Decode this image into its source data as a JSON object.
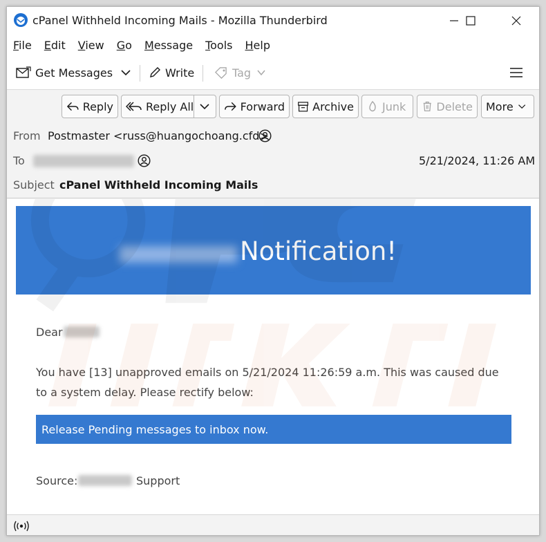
{
  "window": {
    "title": "cPanel Withheld Incoming Mails - Mozilla Thunderbird"
  },
  "menubar": {
    "items": [
      "File",
      "Edit",
      "View",
      "Go",
      "Message",
      "Tools",
      "Help"
    ]
  },
  "toolbar": {
    "get_messages": "Get Messages",
    "write": "Write",
    "tag": "Tag"
  },
  "actions": {
    "reply": "Reply",
    "reply_all": "Reply All",
    "forward": "Forward",
    "archive": "Archive",
    "junk": "Junk",
    "delete": "Delete",
    "more": "More"
  },
  "header": {
    "from_label": "From",
    "from_value": "Postmaster <russ@huangochoang.cfd>",
    "to_label": "To",
    "date": "5/21/2024, 11:26 AM",
    "subject_label": "Subject",
    "subject_value": "cPanel Withheld Incoming Mails"
  },
  "message": {
    "banner_title": "Notification!",
    "greeting": "Dear",
    "paragraph": "You have [13] unapproved emails on 5/21/2024 11:26:59 a.m. This was caused due to a system delay. Please rectify below:",
    "cta": "Release Pending messages to inbox now.",
    "source_label": "Source:",
    "source_suffix": "Support"
  },
  "colors": {
    "banner": "#3579d0",
    "cta": "#3579d0"
  },
  "icons": [
    "thunderbird-icon",
    "minimize-icon",
    "maximize-icon",
    "close-icon",
    "get-messages-icon",
    "chevron-down-icon",
    "pencil-icon",
    "tag-icon",
    "hamburger-menu-icon",
    "reply-icon",
    "reply-all-icon",
    "forward-icon",
    "archive-icon",
    "junk-icon",
    "trash-icon",
    "contact-icon",
    "wifi-status-icon"
  ]
}
